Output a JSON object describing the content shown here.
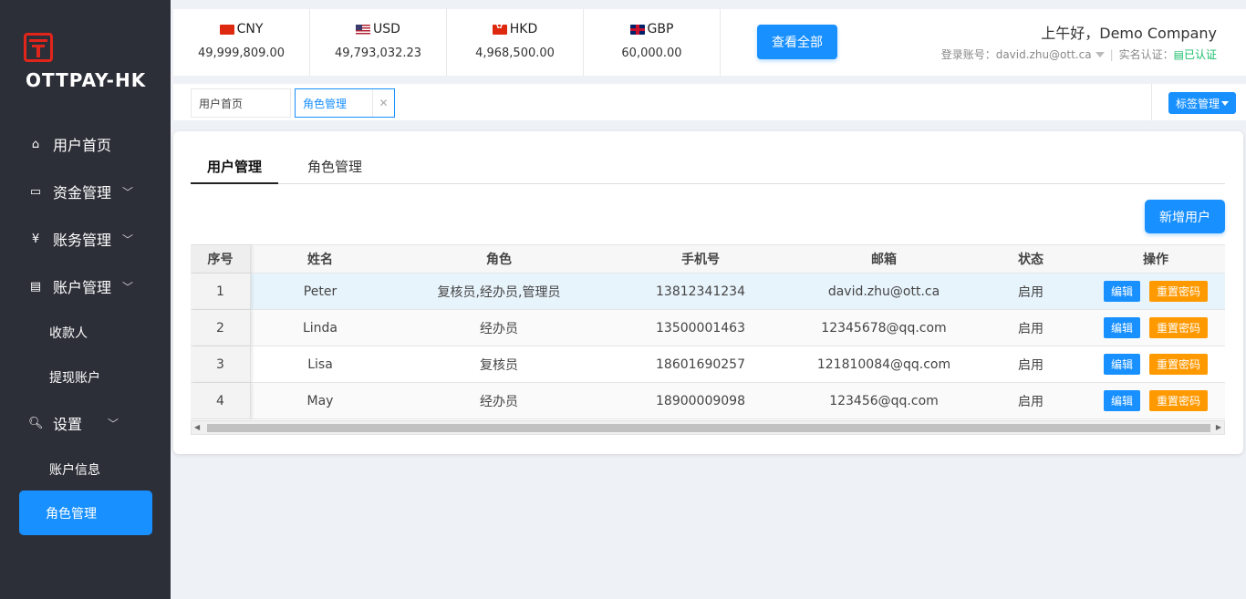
{
  "sidebar": {
    "brand": "OTTPAY-HK",
    "menu": [
      {
        "label": "用户首页",
        "icon": "home-icon"
      },
      {
        "label": "资金管理",
        "icon": "card-icon"
      },
      {
        "label": "账务管理",
        "icon": "yen-icon"
      },
      {
        "label": "账户管理",
        "icon": "id-card-icon"
      },
      {
        "label": "收款人"
      },
      {
        "label": "提现账户"
      },
      {
        "label": "设置",
        "icon": "search-icon"
      },
      {
        "label": "账户信息"
      },
      {
        "label": "角色管理"
      }
    ]
  },
  "header": {
    "currencies": [
      {
        "code": "CNY",
        "amount": "49,999,809.00"
      },
      {
        "code": "USD",
        "amount": "49,793,032.23"
      },
      {
        "code": "HKD",
        "amount": "4,968,500.00"
      },
      {
        "code": "GBP",
        "amount": "60,000.00"
      }
    ],
    "view_all": "查看全部",
    "greeting": "上午好，Demo Company",
    "login_label": "登录账号：",
    "login_account": "david.zhu@ott.ca",
    "verify_label": "实名认证：",
    "verify_status": "已认证"
  },
  "tabs": {
    "items": [
      "用户首页",
      "角色管理"
    ],
    "tag_manage": "标签管理"
  },
  "main": {
    "subtabs": [
      "用户管理",
      "角色管理"
    ],
    "add_user": "新增用户",
    "columns": [
      "序号",
      "姓名",
      "角色",
      "手机号",
      "邮箱",
      "状态",
      "操作"
    ],
    "rows": [
      {
        "idx": "1",
        "name": "Peter",
        "role": "复核员,经办员,管理员",
        "phone": "13812341234",
        "email": "david.zhu@ott.ca",
        "status": "启用"
      },
      {
        "idx": "2",
        "name": "Linda",
        "role": "经办员",
        "phone": "13500001463",
        "email": "12345678@qq.com",
        "status": "启用"
      },
      {
        "idx": "3",
        "name": "Lisa",
        "role": "复核员",
        "phone": "18601690257",
        "email": "121810084@qq.com",
        "status": "启用"
      },
      {
        "idx": "4",
        "name": "May",
        "role": "经办员",
        "phone": "18900009098",
        "email": "123456@qq.com",
        "status": "启用"
      }
    ],
    "edit_label": "编辑",
    "reset_label": "重置密码"
  },
  "colors": {
    "accent": "#1890ff",
    "warning": "#ff9900",
    "sidebar_bg": "#2d2f38",
    "brand_red": "#e1251b",
    "verified": "#19be6b"
  }
}
